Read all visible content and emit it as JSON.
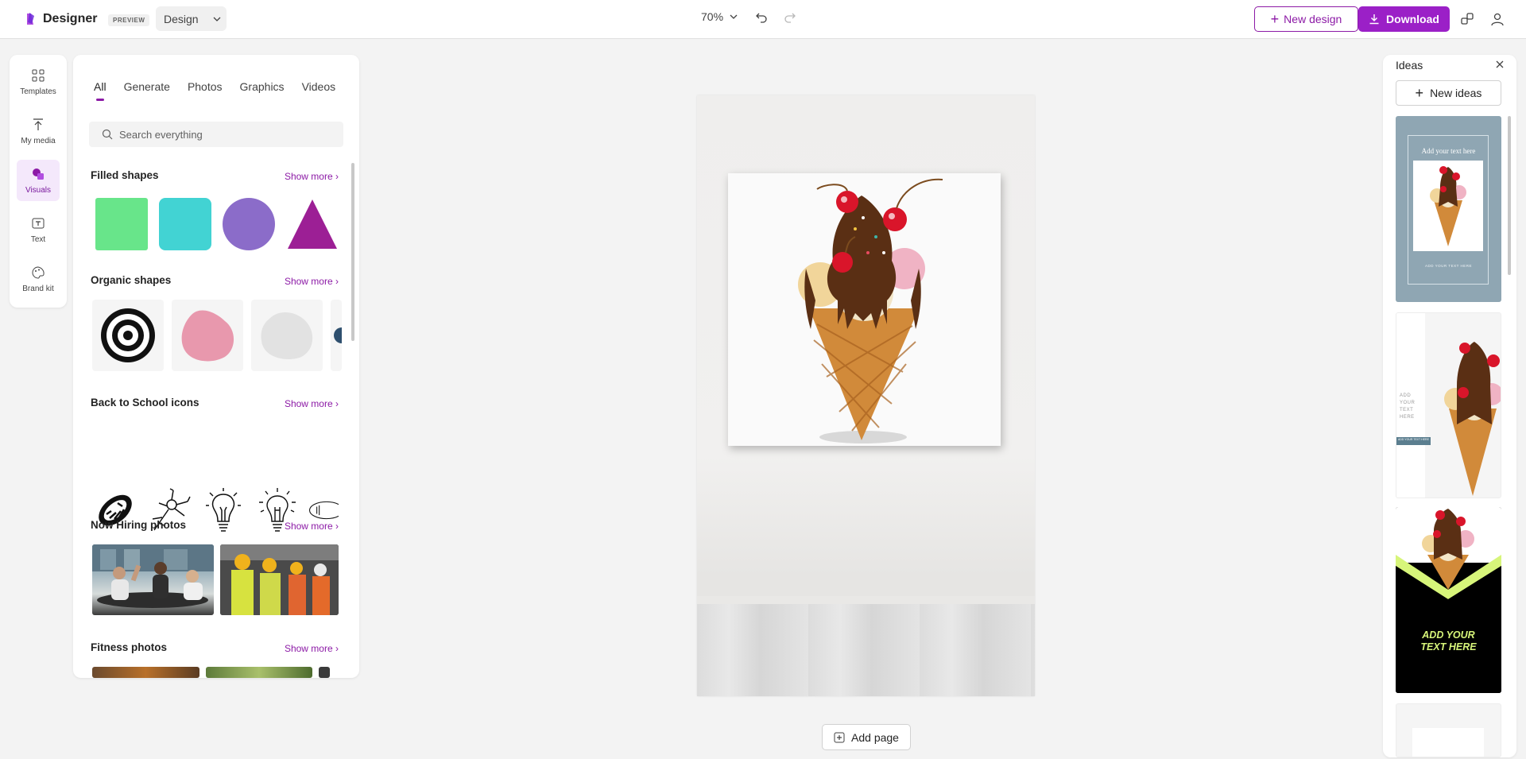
{
  "header": {
    "brand": "Designer",
    "preview_badge": "PREVIEW",
    "mode": "Design",
    "zoom": "70%",
    "new_design": "New design",
    "download": "Download"
  },
  "leftnav": {
    "items": [
      {
        "label": "Templates",
        "icon": "templates-icon"
      },
      {
        "label": "My media",
        "icon": "upload-icon"
      },
      {
        "label": "Visuals",
        "icon": "visuals-icon",
        "active": true
      },
      {
        "label": "Text",
        "icon": "text-icon"
      },
      {
        "label": "Brand kit",
        "icon": "palette-icon"
      }
    ]
  },
  "panel": {
    "tabs": [
      "All",
      "Generate",
      "Photos",
      "Graphics",
      "Videos"
    ],
    "active_tab": "All",
    "search_placeholder": "Search everything",
    "sections": [
      {
        "title": "Filled shapes",
        "show_more": "Show more"
      },
      {
        "title": "Organic shapes",
        "show_more": "Show more"
      },
      {
        "title": "Back to School icons",
        "show_more": "Show more"
      },
      {
        "title": "Now Hiring photos",
        "show_more": "Show more"
      },
      {
        "title": "Fitness photos",
        "show_more": "Show more"
      }
    ]
  },
  "canvas": {
    "add_page": "Add page"
  },
  "ideas": {
    "title": "Ideas",
    "new_ideas": "New ideas",
    "card1_headline": "Add your text here",
    "card1_footer": "ADD YOUR TEXT HERE",
    "card2_text": [
      "ADD",
      "YOUR",
      "TEXT",
      "HERE"
    ],
    "card2_badge": "ADD YOUR TEXT HERE",
    "card3_text_line1": "ADD YOUR",
    "card3_text_line2": "TEXT HERE"
  },
  "colors": {
    "accent": "#8c1aa6",
    "shape_green": "#68e58a",
    "shape_teal": "#42d3d3",
    "shape_purple": "#8b6cc9",
    "shape_magenta": "#9c1f95"
  }
}
